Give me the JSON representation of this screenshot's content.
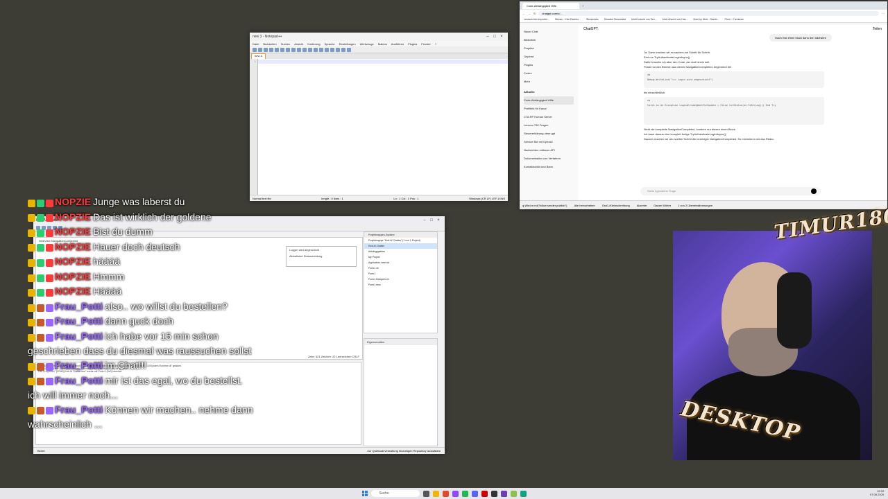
{
  "notepad": {
    "title": "new 3 - Notepad++",
    "menu": [
      "Datei",
      "Bearbeiten",
      "Suchen",
      "Ansicht",
      "Kodierung",
      "Sprache",
      "Einstellungen",
      "Werkzeuge",
      "Makros",
      "Ausführen",
      "Plugins",
      "Fenster",
      "?"
    ],
    "tab": "new 3",
    "line_no": "1",
    "status_left": "Normal text file",
    "status_mid": "length : 0    lines : 1",
    "status_pos": "Ln : 1    Col : 1    Pos : 1",
    "status_right": "Windows (CR LF)    UTF-8    INS"
  },
  "browser": {
    "tab_title": "Code-Abhängigkeit Hilfe",
    "url": "chatgpt.com/c/...",
    "bookmarks": [
      "Lesezeichen importier...",
      "Stream - Kick Dashbo...",
      "Streamlabs",
      "Stoaabs Streamlabs",
      "Mobi Ansicht von Sen...",
      "Mobi Ansicht von Hau...",
      "Mobi by Mobi - Dashb...",
      "Fiverr - Freelance"
    ],
    "sidebar": {
      "items": [
        "Neuer Chat",
        "Bibliothek",
        "Projekte",
        "Gepinnt",
        "Plugins",
        "Codex",
        "Mehr"
      ],
      "section": "Aktuelle",
      "history": [
        "Code-Abhängigkeit Hilfe",
        "Profilbild für Kanal",
        "CTA RP Human Server",
        "Lenovo C30 Fragen",
        "Steuererklärung ohne gpt",
        "Service Bot mit OpenAI",
        "Nachrichten mitlesen API",
        "Dokumentation von Verfahren",
        "Kontaktschild und Bann"
      ]
    },
    "model": "ChatGPT",
    "share": "Teilen",
    "user_bubble": "mach erst einen block dann den nächsten",
    "content": {
      "p1": "Ja. Dann machen wir es sauber und Schritt für Schritt.",
      "p2": "Erst nur TryAuthenticateLoginAsync().",
      "p3": "Dafür brauche ich aber den Code, der dort hinein soll.",
      "p4": "Poste nur den Bereich aus deiner NavigationCompleted, beginnend bei",
      "code1_lang": "vb",
      "code1": "Debug.WriteLine(\"=== Login wird abgeschickt\")",
      "p5": "bis einschließlich",
      "code2_lang": "vb",
      "code2": "Catch ex As Exception  LoginAlreadyWaitForUpdate = False  txtStatus(ex.ToString())  End Try",
      "p6": "Nicht die komplette NavigationCompleted, sondern nur diesen einen Block.",
      "p7": "Ich baue daraus eine komplett fertige TryAuthenticateLoginAsync().",
      "p8": "Danach machen wir als zweiten Schritt die bereinigte NavigationCompleted. So minimieren wir das Risiko."
    },
    "prompt_placeholder": "Stelle irgendeine Frage",
    "findbar": [
      "q.Wird.re.nd(\"follow sender.publish\")",
      "Alle hervorheben",
      "Groß-/Kleinschreibung",
      "Akzente",
      "Ganze Wörter",
      "1 von 2 Übereinstimmungen"
    ]
  },
  "vs": {
    "title": "Kick AI Chatter",
    "code_title": "WebView NavigationCompleted",
    "popup": [
      "Logger wird abgeschickt",
      "Aktualisiert Statusmeldung"
    ],
    "status_code": "Zeile: 521   Zeichen: 22   Leerzeichen   CRLF",
    "output_lines": [
      "'Kick AI Chatter.exe' (CoreCLR: clrhost): 'C:\\Program Files\\dotnet\\shared\\Microsoft.NETCore.App\\8.0.10\\System.Runtime.dll' geladen.",
      "Kick AI Chatter.exe (CoreCLR: clrhost): 'Microsoft.Web.WebView2.Core.dll' geladen.",
      "Das Programm \"[12345] Kick AI Chatter.exe\" wurde mit Code 0 (0x0) beendet."
    ],
    "solution_title": "Projektmappen-Explorer",
    "solution_items": [
      "Projektmappe \"Kick AI Chatter\" (1 von 1 Projekt)",
      "Kick AI Chatter",
      "Abhängigkeiten",
      "My Project",
      "Application.xaml.vb",
      "Form1.vb",
      "Form1",
      "Form1.Designer.vb",
      "Form1.resx"
    ],
    "properties_title": "Eigenschaften",
    "status_left": "Bereit",
    "status_right": "Zur Quellcodeverwaltung hinzufügen   Repository auswählen"
  },
  "chat": [
    {
      "user": "NOPZIE",
      "color": "red",
      "text": "Junge was laberst du"
    },
    {
      "user": "NOPZIE",
      "color": "red",
      "text": "Das ist wirklich der goldene"
    },
    {
      "user": "NOPZIE",
      "color": "red",
      "text": "Bist du dumm"
    },
    {
      "user": "NOPZIE",
      "color": "red",
      "text": "Hauer doch deutsch"
    },
    {
      "user": "NOPZIE",
      "color": "red",
      "text": "hääää"
    },
    {
      "user": "NOPZIE",
      "color": "red",
      "text": "Hmmm"
    },
    {
      "user": "NOPZIE",
      "color": "red",
      "text": "Hääää"
    },
    {
      "user": "Frau_Potti",
      "color": "purple",
      "text": "also.. wo willst du bestellen?"
    },
    {
      "user": "Frau_Potti",
      "color": "purple",
      "text": "dann guck doch"
    },
    {
      "user": "Frau_Potti",
      "color": "purple",
      "text": "ich habe vor 15 min schon"
    },
    {
      "user": "",
      "color": "",
      "text": "geschrieben dass du diesmal was raussuchen sollst"
    },
    {
      "user": "Frau_Potti",
      "color": "purple",
      "text": "im Chat!!!"
    },
    {
      "user": "Frau_Potti",
      "color": "purple",
      "text": "mir ist das egal, wo du bestellst."
    },
    {
      "user": "",
      "color": "",
      "text": "ich will immer noch..."
    },
    {
      "user": "Frau_Potti",
      "color": "purple",
      "text": "Können wir machen.. nehme dann"
    },
    {
      "user": "",
      "color": "",
      "text": "wahrscheinlich ..."
    }
  ],
  "overlay": {
    "logo_top": "TIMUR1804",
    "logo_bottom": "DESKTOP"
  },
  "taskbar": {
    "search": "Suche",
    "time": "19:33",
    "date": "07.08.2025"
  },
  "colors": {
    "desktop": "#3d3d36",
    "nopzie": "#ff3a3a",
    "potti": "#9a66ff"
  }
}
